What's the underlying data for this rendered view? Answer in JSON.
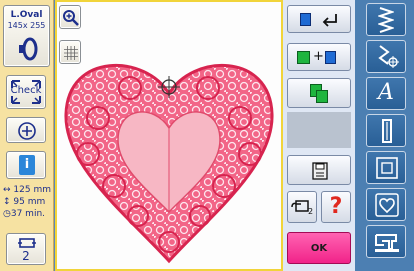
{
  "left": {
    "design_name": "L.Oval",
    "design_size": "145x 255",
    "check_label": "Check",
    "width_value": "125 mm",
    "height_value": "95 mm",
    "time_value": "37 min.",
    "multi_count": "2"
  },
  "right": {
    "hoop_count": "2",
    "help_label": "?",
    "ok_label": "OK"
  },
  "sidebar": {
    "font_label": "A"
  },
  "colors": {
    "accent_pink": "#f0288c",
    "embroidery": "#ee3b6d",
    "canvas_border": "#f1d43a",
    "sidebar_bg": "#4c7fb2"
  }
}
